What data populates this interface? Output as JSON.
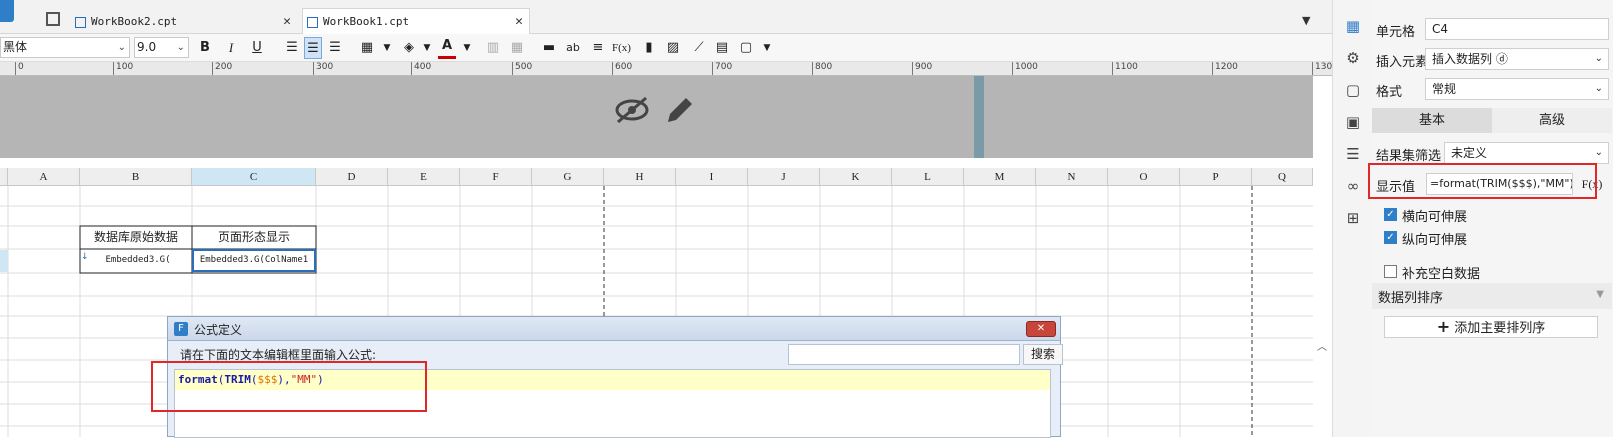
{
  "tabs": [
    {
      "label": "WorkBook2.cpt",
      "active": false
    },
    {
      "label": "WorkBook1.cpt",
      "active": true
    }
  ],
  "toolbar": {
    "font_name": "黑体",
    "font_size": "9.0",
    "bold": "B",
    "italic": "I",
    "underline": "U",
    "text_tool": "ab",
    "formula_tool": "F(x)"
  },
  "ruler": {
    "ticks": [
      "0",
      "100",
      "200",
      "300",
      "400",
      "500",
      "600",
      "700",
      "800",
      "900",
      "1000",
      "1100",
      "1200",
      "130"
    ]
  },
  "grid": {
    "columns": [
      "A",
      "B",
      "C",
      "D",
      "E",
      "F",
      "G",
      "H",
      "I",
      "J",
      "K",
      "L",
      "M",
      "N",
      "O",
      "P",
      "Q"
    ],
    "selected_column": "C",
    "header_b": "数据库原始数据",
    "header_c": "页面形态显示",
    "cell_b4": "Embedded3.G(",
    "cell_c4": "Embedded3.G(ColName1"
  },
  "dialog": {
    "title": "公式定义",
    "instruction": "请在下面的文本编辑框里面输入公式:",
    "search_placeholder": "",
    "search_button": "搜索",
    "formula_parts": {
      "fn1": "format",
      "p1": "(",
      "fn2": "TRIM",
      "p2": "(",
      "arg": "$$$",
      "p3": "),",
      "str": "\"MM\"",
      "p4": ")"
    },
    "close_icon": "close-icon"
  },
  "panel": {
    "cell_label": "单元格",
    "cell_value": "C4",
    "insert_label": "插入元素",
    "insert_value": "插入数据列 ⓓ",
    "format_label": "格式",
    "format_value": "常规",
    "tab_basic": "基本",
    "tab_advanced": "高级",
    "filter_label": "结果集筛选",
    "filter_value": "未定义",
    "display_label": "显示值",
    "display_value": "=format(TRIM($$$),\"MM\")",
    "fx_button": "F(x)",
    "horizontal_expand": "横向可伸展",
    "vertical_expand": "纵向可伸展",
    "fill_blank": "补充空白数据",
    "sort_label": "数据列排序",
    "add_sort_button": "添加主要排列序"
  },
  "colors": {
    "accent": "#2f7ec8",
    "highlight_red": "#e02828",
    "formula_bg": "#ffffc8"
  }
}
